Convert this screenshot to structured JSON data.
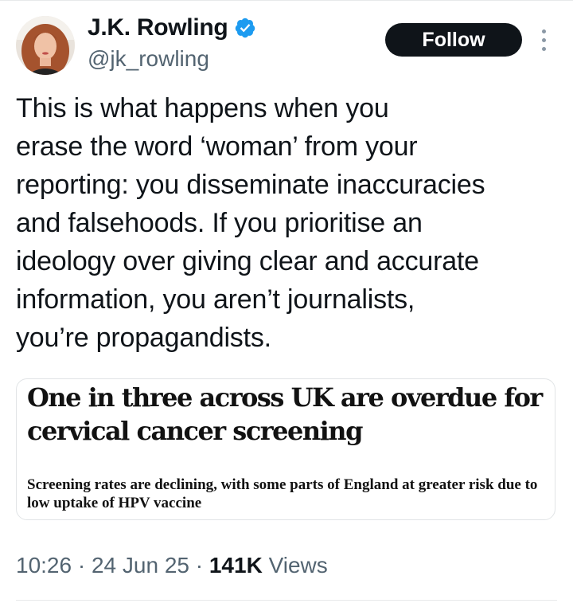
{
  "author": {
    "display_name": "J.K. Rowling",
    "handle": "@jk_rowling",
    "verified_icon": "verified-badge-icon",
    "verified_color": "#1d9bf0"
  },
  "actions": {
    "follow_label": "Follow",
    "more_icon": "more-vertical-icon"
  },
  "tweet": {
    "text": "This is what happens when you\nerase the word ‘woman’ from your\nreporting: you disseminate inaccuracies\nand falsehoods. If you prioritise an\nideology over giving clear and accurate\ninformation, you aren’t journalists,\nyou’re propagandists."
  },
  "card": {
    "headline": "One in three across UK are overdue for cervical cancer screening",
    "standfirst": "Screening rates are declining, with some parts of England at greater risk due to low uptake of HPV vaccine"
  },
  "meta": {
    "time": "10:26",
    "separator": "·",
    "date": "24 Jun 25",
    "views_count": "141K",
    "views_label": "Views"
  },
  "colors": {
    "text_primary": "#0f1419",
    "text_secondary": "#536471",
    "follow_bg": "#0f1419"
  }
}
